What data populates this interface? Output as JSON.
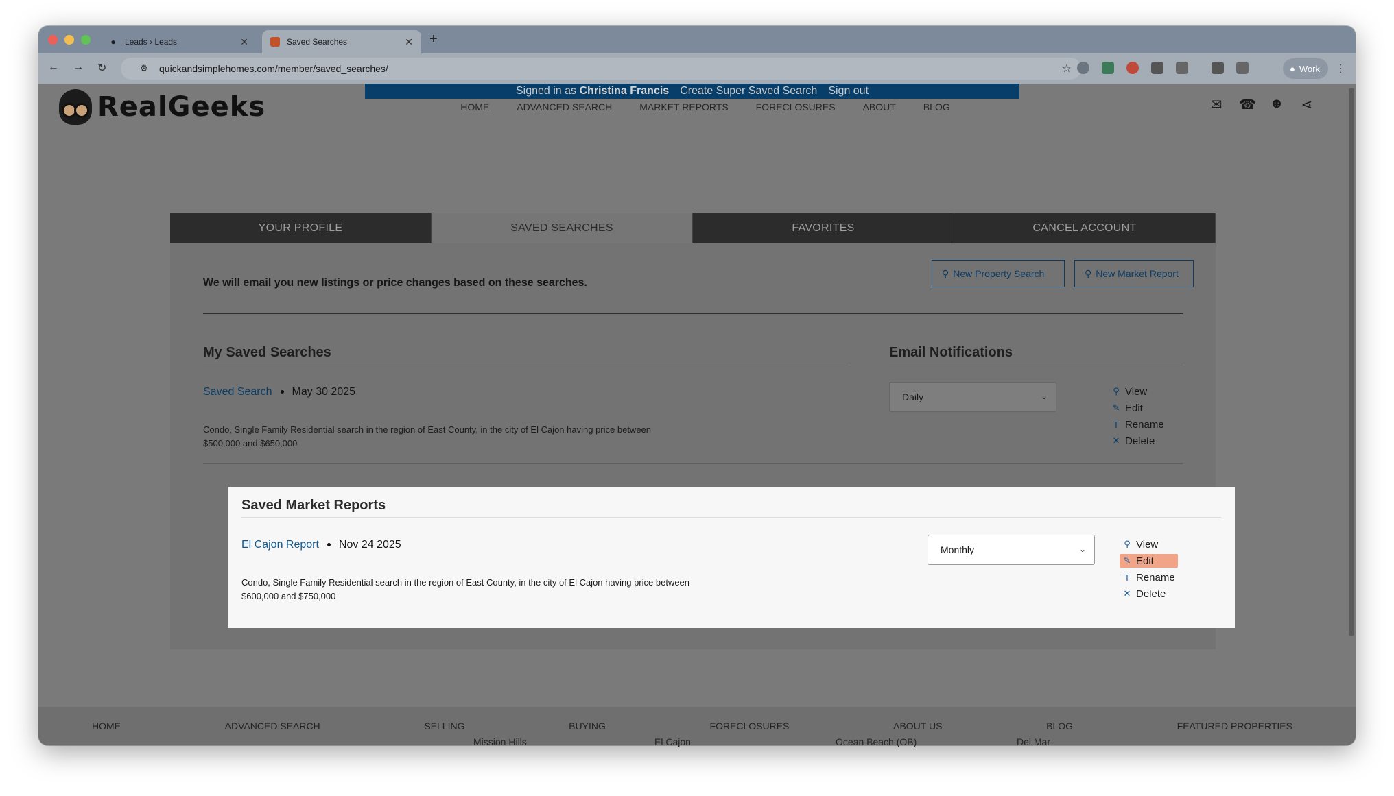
{
  "browser": {
    "tabs": [
      {
        "label": "Leads › Leads",
        "active": false
      },
      {
        "label": "Saved Searches",
        "active": true
      }
    ],
    "url": "quickandsimplehomes.com/member/saved_searches/",
    "profile_label": "Work"
  },
  "header": {
    "logo_text": "RealGeeks",
    "signed_in_prefix": "Signed in as",
    "signed_in_name": "Christina Francis",
    "create_super": "Create Super Saved Search",
    "sign_out": "Sign out",
    "nav": [
      "HOME",
      "ADVANCED SEARCH",
      "MARKET REPORTS",
      "FORECLOSURES",
      "ABOUT",
      "BLOG"
    ]
  },
  "profile_tabs": [
    {
      "label": "YOUR PROFILE",
      "active": false
    },
    {
      "label": "SAVED SEARCHES",
      "active": true
    },
    {
      "label": "FAVORITES",
      "active": false
    },
    {
      "label": "CANCEL ACCOUNT",
      "active": false
    }
  ],
  "intro_text": "We will email you new listings or price changes based on these searches.",
  "buttons": {
    "new_property_search": "New Property Search",
    "new_market_report": "New Market Report"
  },
  "saved_searches": {
    "title": "My Saved Searches",
    "notifications_title": "Email Notifications",
    "item": {
      "name": "Saved Search",
      "date": "May 30 2025",
      "description": "Condo, Single Family Residential search in the region of East County, in the city of El Cajon having price between $500,000 and $650,000",
      "frequency": "Daily"
    }
  },
  "market_reports": {
    "title": "Saved Market Reports",
    "item": {
      "name": "El Cajon Report",
      "date": "Nov 24 2025",
      "description": "Condo, Single Family Residential search in the region of East County, in the city of El Cajon having price between $600,000 and $750,000",
      "frequency": "Monthly"
    }
  },
  "actions": {
    "view": "View",
    "edit": "Edit",
    "rename": "Rename",
    "delete": "Delete"
  },
  "footer": {
    "nav": [
      "HOME",
      "ADVANCED SEARCH",
      "SELLING",
      "BUYING",
      "FORECLOSURES",
      "ABOUT US",
      "BLOG",
      "FEATURED PROPERTIES"
    ],
    "cities": [
      "Mission Hills",
      "El Cajon",
      "Ocean Beach (OB)",
      "Del Mar"
    ]
  },
  "colors": {
    "brand_navy": "#083f6a",
    "link_blue": "#0f5a94",
    "highlight": "#f2a488"
  }
}
